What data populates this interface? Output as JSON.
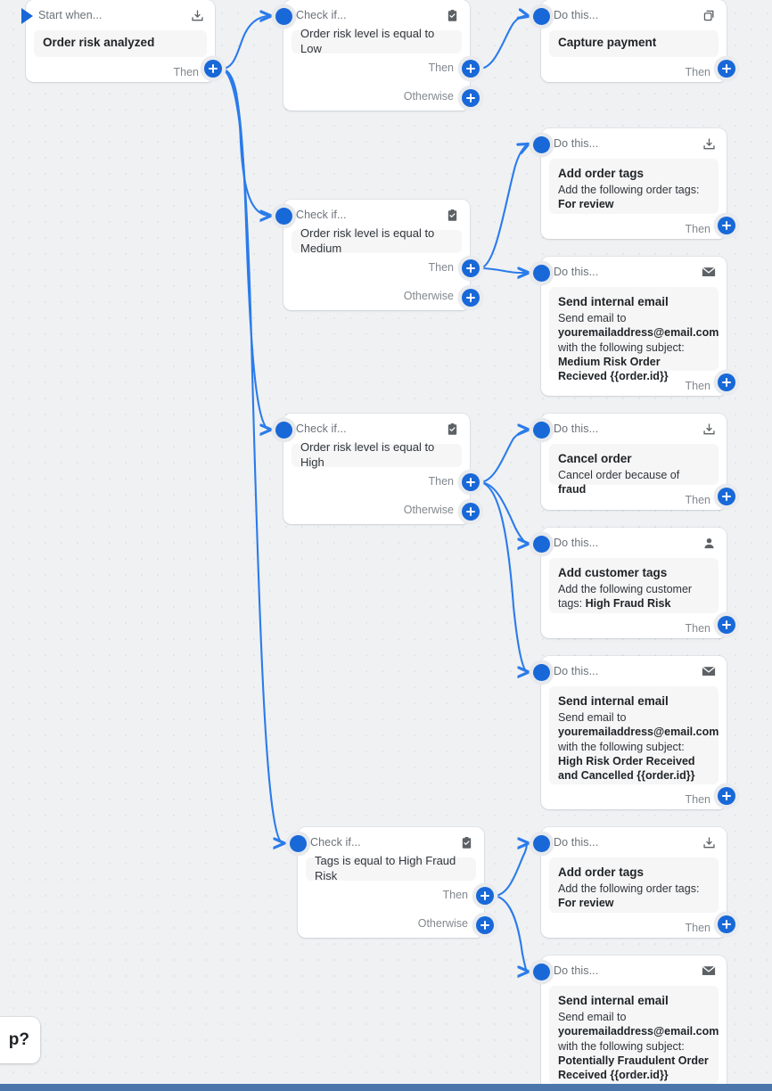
{
  "app": {
    "canvas_label": "workflow-canvas",
    "accent_color": "#1868d8",
    "background_color": "#eff1f3",
    "bottom_bar_color": "#4a76ab"
  },
  "labels": {
    "trigger_head": "Start when...",
    "condition_head": "Check if...",
    "action_head": "Do this...",
    "then": "Then",
    "otherwise": "Otherwise"
  },
  "help_widget": {
    "text": "p?"
  },
  "nodes": [
    {
      "id": "trigger",
      "kind": "trigger",
      "head": "Start when...",
      "icon": "inbox-download-icon",
      "title": "Order risk analyzed",
      "outputs": [
        "Then"
      ]
    },
    {
      "id": "check-low",
      "kind": "condition",
      "head": "Check if...",
      "icon": "clipboard-check-icon",
      "condition": "Order risk level is equal to Low",
      "outputs": [
        "Then",
        "Otherwise"
      ]
    },
    {
      "id": "capture-payment",
      "kind": "action",
      "head": "Do this...",
      "icon": "capture-payment-icon",
      "title": "Capture payment",
      "detail": "",
      "outputs": [
        "Then"
      ]
    },
    {
      "id": "check-medium",
      "kind": "condition",
      "head": "Check if...",
      "icon": "clipboard-check-icon",
      "condition": "Order risk level is equal to Medium",
      "outputs": [
        "Then",
        "Otherwise"
      ]
    },
    {
      "id": "add-order-tags-medium",
      "kind": "action",
      "head": "Do this...",
      "icon": "order-tag-icon",
      "title": "Add order tags",
      "detail_prefix": "Add the following order tags: ",
      "detail_bold": "For review",
      "outputs": [
        "Then"
      ]
    },
    {
      "id": "send-email-medium",
      "kind": "action",
      "head": "Do this...",
      "icon": "envelope-icon",
      "title": "Send internal email",
      "line1": "Send email to",
      "email": "youremailaddress@email.com",
      "line2": "with the following subject: ",
      "subject": "Medium Risk Order Recieved {{order.id}}",
      "outputs": [
        "Then"
      ]
    },
    {
      "id": "check-high",
      "kind": "condition",
      "head": "Check if...",
      "icon": "clipboard-check-icon",
      "condition": "Order risk level is equal to High",
      "outputs": [
        "Then",
        "Otherwise"
      ]
    },
    {
      "id": "cancel-order",
      "kind": "action",
      "head": "Do this...",
      "icon": "order-tag-icon",
      "title": "Cancel order",
      "detail_prefix": "Cancel order because of ",
      "detail_bold": "fraud",
      "outputs": [
        "Then"
      ]
    },
    {
      "id": "add-customer-tags",
      "kind": "action",
      "head": "Do this...",
      "icon": "customer-icon",
      "title": "Add customer tags",
      "detail_prefix": "Add the following customer tags: ",
      "detail_bold": "High Fraud Risk",
      "outputs": [
        "Then"
      ]
    },
    {
      "id": "send-email-high",
      "kind": "action",
      "head": "Do this...",
      "icon": "envelope-icon",
      "title": "Send internal email",
      "line1": "Send email to",
      "email": "youremailaddress@email.com",
      "line2": "with the following subject: ",
      "subject": "High Risk Order Received and Cancelled {{order.id}}",
      "outputs": [
        "Then"
      ]
    },
    {
      "id": "check-tags",
      "kind": "condition",
      "head": "Check if...",
      "icon": "clipboard-check-icon",
      "condition": "Tags is equal to High Fraud Risk",
      "outputs": [
        "Then",
        "Otherwise"
      ]
    },
    {
      "id": "add-order-tags-fraud",
      "kind": "action",
      "head": "Do this...",
      "icon": "order-tag-icon",
      "title": "Add order tags",
      "detail_prefix": "Add the following order tags: ",
      "detail_bold": "For review",
      "outputs": [
        "Then"
      ]
    },
    {
      "id": "send-email-fraud",
      "kind": "action",
      "head": "Do this...",
      "icon": "envelope-icon",
      "title": "Send internal email",
      "line1": "Send email to",
      "email": "youremailaddress@email.com",
      "line2": "with the following subject: ",
      "subject": "Potentially Fraudulent Order Received {{order.id}}",
      "outputs": []
    }
  ]
}
